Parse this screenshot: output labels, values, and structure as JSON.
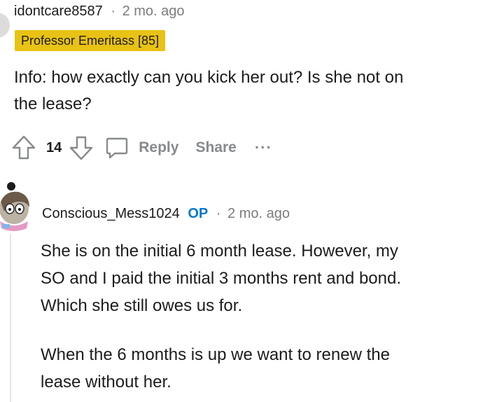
{
  "comment": {
    "username": "idontcare8587",
    "separator": "·",
    "time": "2 mo. ago",
    "flair": "Professor Emeritass [85]",
    "body_lines": [
      "Info: how exactly can you kick her out? Is she not on",
      "the lease?"
    ],
    "votes": "14",
    "actions": {
      "reply": "Reply",
      "share": "Share",
      "more": "···"
    }
  },
  "reply": {
    "username": "Conscious_Mess1024",
    "op_badge": "OP",
    "separator": "·",
    "time": "2 mo. ago",
    "paragraph1_lines": [
      "She is on the initial 6 month lease. However, my",
      "SO and I paid the initial 3 months rent and bond.",
      "Which she still owes us for."
    ],
    "paragraph2_lines": [
      "When the 6 months is up we want to renew the",
      "lease without her."
    ]
  },
  "colors": {
    "flair_bg": "#e8c214",
    "op_blue": "#0079d3",
    "muted_gray": "#878a8c",
    "text": "#1c1c1c"
  },
  "icons": [
    "upvote-icon",
    "downvote-icon",
    "comment-icon",
    "avatar-partial",
    "snoo-avatar"
  ]
}
